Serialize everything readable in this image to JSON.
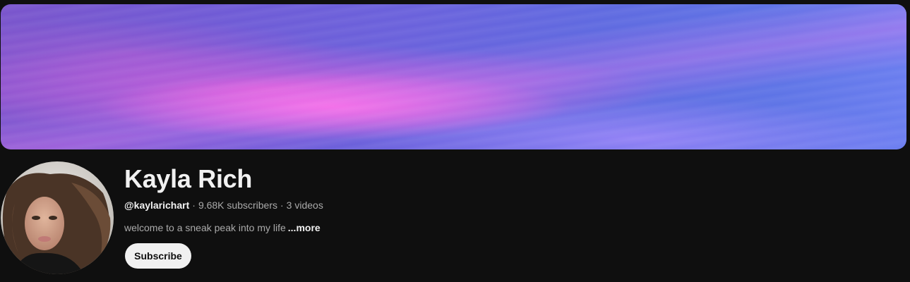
{
  "channel": {
    "name": "Kayla Rich",
    "handle": "@kaylarichart",
    "separator": "·",
    "subscribers": "9.68K subscribers",
    "videos": "3 videos",
    "description": "welcome to a sneak peak into my life",
    "more_label": "...more"
  },
  "subscribe": {
    "label": "Subscribe"
  },
  "colors": {
    "background": "#0f0f0f",
    "text_primary": "#f1f1f1",
    "text_secondary": "#aaaaaa",
    "button_bg": "#f1f1f1"
  }
}
